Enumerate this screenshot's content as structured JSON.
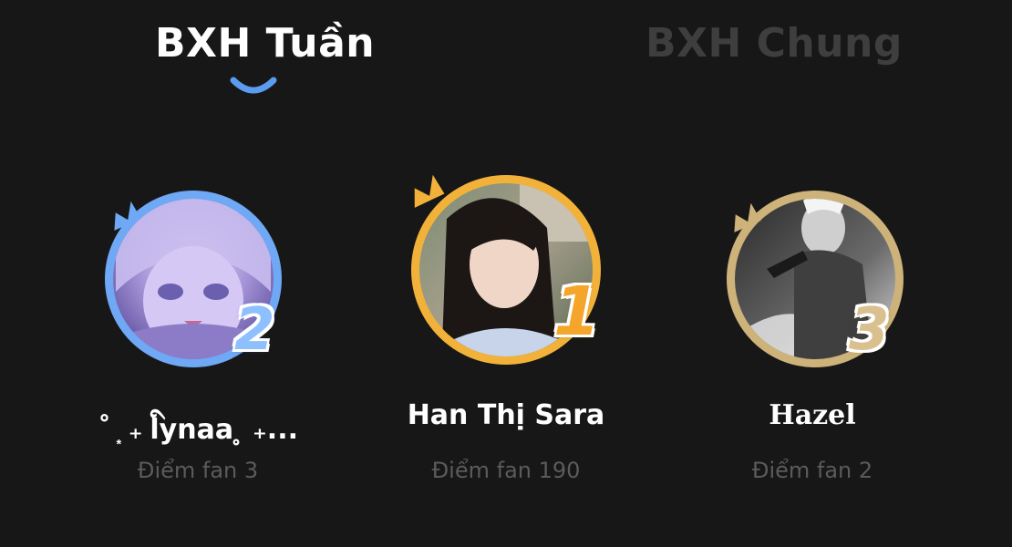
{
  "tabs": {
    "weekly": "BXH Tuần",
    "overall": "BXH Chung",
    "active": "weekly"
  },
  "colors": {
    "background": "#171717",
    "active_tab": "#ffffff",
    "inactive_tab": "#3e3e3e",
    "indicator": "#5b9cf0",
    "rank_1": "#f2b23a",
    "rank_2": "#6fa8f5",
    "rank_3": "#cdb27a",
    "score_text": "#5b5b5b"
  },
  "leaderboard": [
    {
      "rank": "2",
      "name": "˚ ͙ ₊ ིlynaa ̥ ₊...",
      "score_text": "Điểm fan 3",
      "ring_color": "#6fa8f5"
    },
    {
      "rank": "1",
      "name": "Han Thị Sara",
      "score_text": "Điểm fan 190",
      "ring_color": "#f2b23a"
    },
    {
      "rank": "3",
      "name": "Hazel",
      "score_text": "Điểm fan 2",
      "ring_color": "#cdb27a"
    }
  ]
}
